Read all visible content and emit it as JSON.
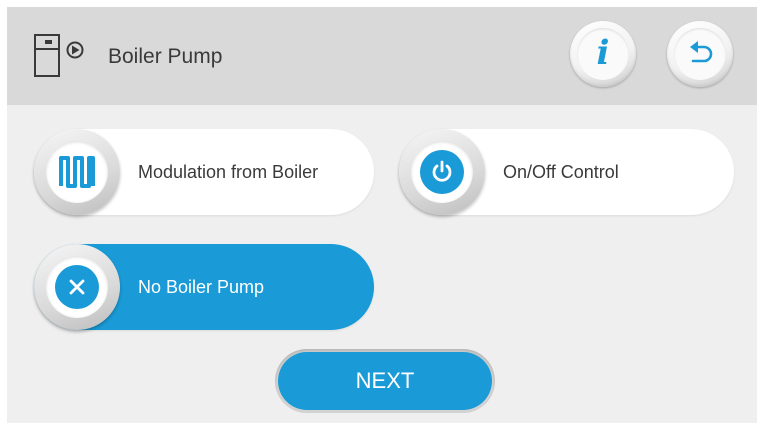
{
  "header": {
    "title": "Boiler Pump",
    "icon": "boiler-pump-icon",
    "info_icon": "info-icon",
    "back_icon": "back-arrow-icon"
  },
  "options": [
    {
      "label": "Modulation from Boiler",
      "icon": "modulation-wave-icon",
      "selected": false
    },
    {
      "label": "On/Off Control",
      "icon": "power-icon",
      "selected": false
    },
    {
      "label": "No Boiler Pump",
      "icon": "close-icon",
      "selected": true
    }
  ],
  "next_label": "NEXT",
  "colors": {
    "accent": "#1a9ad6",
    "header_bg": "#d9d9d9",
    "screen_bg": "#efefef",
    "text": "#3a3a3a"
  }
}
